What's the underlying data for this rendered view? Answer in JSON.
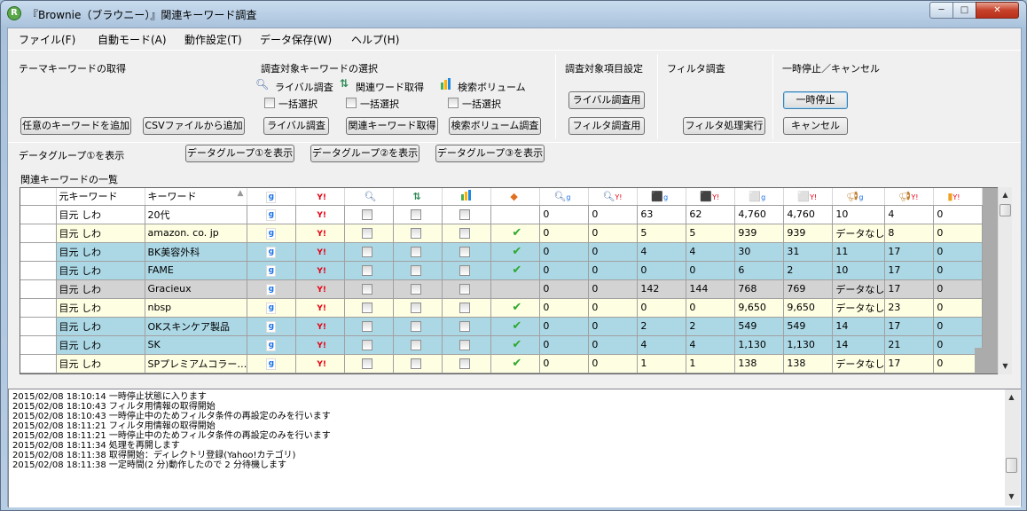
{
  "window": {
    "title": "『Brownie（ブラウニー）』関連キーワード調査",
    "app_icon_letter": "R",
    "minimize": "─",
    "maximize": "□",
    "close": "✕"
  },
  "menu": [
    "ファイル(F)",
    "自動モード(A)",
    "動作設定(T)",
    "データ保存(W)",
    "ヘルプ(H)"
  ],
  "sections": {
    "theme": {
      "title": "テーマキーワードの取得",
      "btn_any": "任意のキーワードを追加",
      "btn_csv": "CSVファイルから追加"
    },
    "target": {
      "title": "調査対象キーワードの選択",
      "opt1": "ライバル調査",
      "opt2": "関連ワード取得",
      "opt3": "検索ボリューム",
      "bulk": "一括選択",
      "btn1": "ライバル調査",
      "btn2": "関連キーワード取得",
      "btn3": "検索ボリューム調査"
    },
    "items": {
      "title": "調査対象項目設定",
      "btn1": "ライバル調査用",
      "btn2": "フィルタ調査用"
    },
    "filter": {
      "title": "フィルタ調査",
      "btn": "フィルタ処理実行"
    },
    "pause": {
      "title": "一時停止／キャンセル",
      "btn_pause": "一時停止",
      "btn_cancel": "キャンセル"
    }
  },
  "group": {
    "label": "データグループ①を表示",
    "btn1": "データグループ①を表示",
    "btn2": "データグループ②を表示",
    "btn3": "データグループ③を表示"
  },
  "list_title": "関連キーワードの一覧",
  "table": {
    "headers": {
      "src": "元キーワード",
      "kw": "キーワード"
    },
    "rows": [
      {
        "src": "目元 しわ",
        "kw": "20代",
        "ok": false,
        "v": [
          "0",
          "0",
          "63",
          "62",
          "4,760",
          "4,760",
          "10",
          "4",
          "0"
        ],
        "bg": "#ffffff"
      },
      {
        "src": "目元 しわ",
        "kw": "amazon. co. jp",
        "ok": true,
        "v": [
          "0",
          "0",
          "5",
          "5",
          "939",
          "939",
          "データなし",
          "8",
          "0"
        ],
        "bg": "#fefee2"
      },
      {
        "src": "目元 しわ",
        "kw": "BK美容外科",
        "ok": true,
        "v": [
          "0",
          "0",
          "4",
          "4",
          "30",
          "31",
          "11",
          "17",
          "0"
        ],
        "bg": "#acd8e6"
      },
      {
        "src": "目元 しわ",
        "kw": "FAME",
        "ok": true,
        "v": [
          "0",
          "0",
          "0",
          "0",
          "6",
          "2",
          "10",
          "17",
          "0"
        ],
        "bg": "#acd8e6"
      },
      {
        "src": "目元 しわ",
        "kw": "Gracieux",
        "ok": false,
        "v": [
          "0",
          "0",
          "142",
          "144",
          "768",
          "769",
          "データなし",
          "17",
          "0"
        ],
        "bg": "#d3d3d3"
      },
      {
        "src": "目元 しわ",
        "kw": "nbsp",
        "ok": true,
        "v": [
          "0",
          "0",
          "0",
          "0",
          "9,650",
          "9,650",
          "データなし",
          "23",
          "0"
        ],
        "bg": "#fefee2"
      },
      {
        "src": "目元 しわ",
        "kw": "OKスキンケア製品",
        "ok": true,
        "v": [
          "0",
          "0",
          "2",
          "2",
          "549",
          "549",
          "14",
          "17",
          "0"
        ],
        "bg": "#acd8e6"
      },
      {
        "src": "目元 しわ",
        "kw": "SK",
        "ok": true,
        "v": [
          "0",
          "0",
          "4",
          "4",
          "1,130",
          "1,130",
          "14",
          "21",
          "0"
        ],
        "bg": "#acd8e6"
      },
      {
        "src": "目元 しわ",
        "kw": "SPプレミアムコラー…",
        "ok": true,
        "v": [
          "0",
          "0",
          "1",
          "1",
          "138",
          "138",
          "データなし",
          "17",
          "0"
        ],
        "bg": "#fefee2"
      }
    ]
  },
  "log": [
    "2015/02/08 18:10:14 一時停止状態に入ります",
    "2015/02/08 18:10:43 フィルタ用情報の取得開始",
    "2015/02/08 18:10:43 一時停止中のためフィルタ条件の再設定のみを行います",
    "2015/02/08 18:11:21 フィルタ用情報の取得開始",
    "2015/02/08 18:11:21 一時停止中のためフィルタ条件の再設定のみを行います",
    "2015/02/08 18:11:34 処理を再開します",
    "2015/02/08 18:11:38 取得開始：ディレクトリ登録(Yahoo!カテゴリ)",
    "2015/02/08 18:11:38 一定時間(2 分)動作したので 2 分待機します"
  ]
}
